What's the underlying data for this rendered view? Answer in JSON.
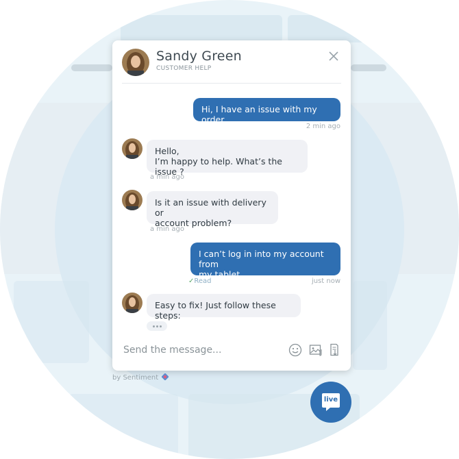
{
  "agent": {
    "name": "Sandy Green",
    "role": "CUSTOMER HELP"
  },
  "messages": [
    {
      "text": "Hi, I have an issue with my order.",
      "time": "2 min ago"
    },
    {
      "text_lines": [
        "Hello,",
        "I’m happy to help. What’s the issue ?"
      ],
      "time": "a min ago"
    },
    {
      "text_lines": [
        "Is it an issue with delivery or",
        "account problem?"
      ],
      "time": "a min ago"
    },
    {
      "text_lines": [
        "I can’t log in into my account from",
        "my tablet."
      ],
      "time": "just now",
      "status": "Read"
    },
    {
      "text": "Easy to fix! Just follow these steps:"
    }
  ],
  "composer": {
    "placeholder": "Send the message..."
  },
  "footer": {
    "by_text": "by Sentiment"
  },
  "launcher": {
    "label": "live"
  },
  "colors": {
    "accent": "#2f6fb2",
    "incoming_bubble": "#f0f1f5"
  },
  "icons": [
    "close-icon",
    "emoji-icon",
    "image-attach-icon",
    "file-attach-icon",
    "chat-bubble-icon"
  ]
}
